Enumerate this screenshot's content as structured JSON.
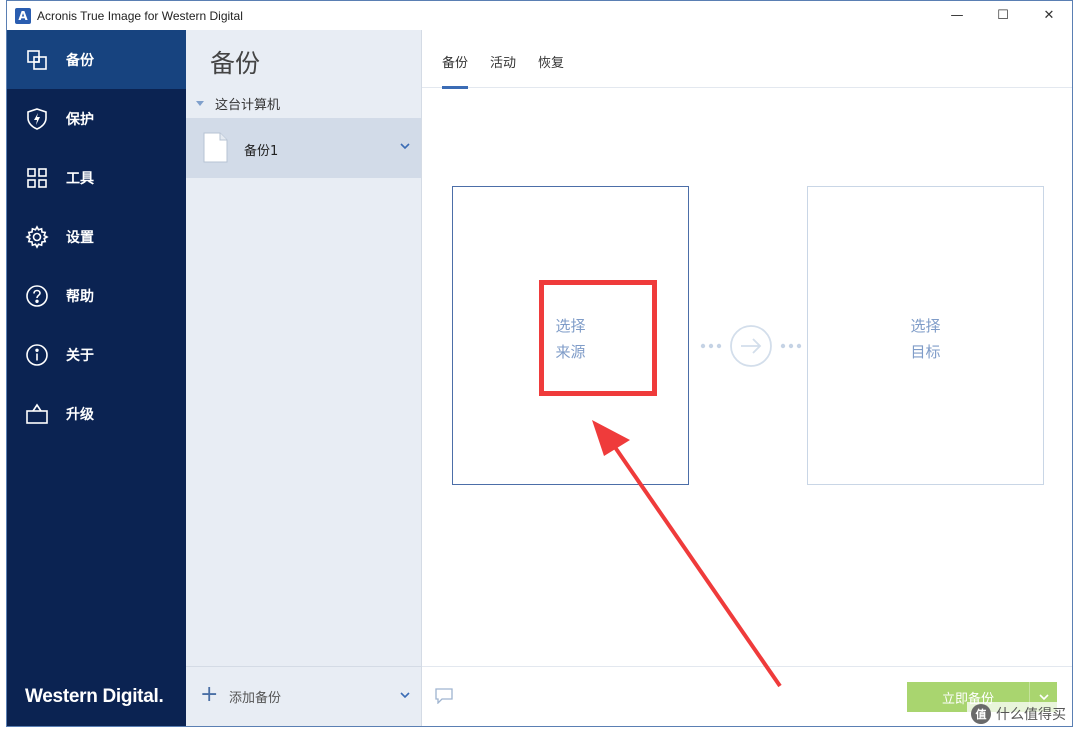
{
  "window": {
    "title": "Acronis True Image for Western Digital",
    "app_icon_letter": "A",
    "controls": {
      "minimize": "—",
      "maximize": "☐",
      "close": "✕"
    }
  },
  "sidebar": {
    "items": [
      {
        "label": "备份",
        "icon": "backup-icon",
        "active": true
      },
      {
        "label": "保护",
        "icon": "shield-icon",
        "active": false
      },
      {
        "label": "工具",
        "icon": "tools-grid-icon",
        "active": false
      },
      {
        "label": "设置",
        "icon": "gear-icon",
        "active": false
      },
      {
        "label": "帮助",
        "icon": "help-icon",
        "active": false
      },
      {
        "label": "关于",
        "icon": "info-icon",
        "active": false
      },
      {
        "label": "升级",
        "icon": "basket-icon",
        "active": false
      }
    ],
    "brand": "Western Digital."
  },
  "list_panel": {
    "title": "备份",
    "group": "这台计算机",
    "items": [
      {
        "name": "备份1",
        "icon": "file-icon"
      }
    ],
    "add_label": "添加备份"
  },
  "main": {
    "tabs": [
      {
        "label": "备份",
        "active": true
      },
      {
        "label": "活动",
        "active": false
      },
      {
        "label": "恢复",
        "active": false
      }
    ],
    "source": {
      "line1": "选择",
      "line2": "来源"
    },
    "target": {
      "line1": "选择",
      "line2": "目标"
    },
    "backup_now": "立即备份"
  },
  "watermark": {
    "logo": "值",
    "text": "什么值得买"
  },
  "colors": {
    "sidebar_bg": "#0b2352",
    "sidebar_active": "#17437f",
    "list_bg": "#e8edf4",
    "accent": "#3b6cb5",
    "annotation": "#ef3b3b",
    "button_green": "#a9d56f"
  }
}
